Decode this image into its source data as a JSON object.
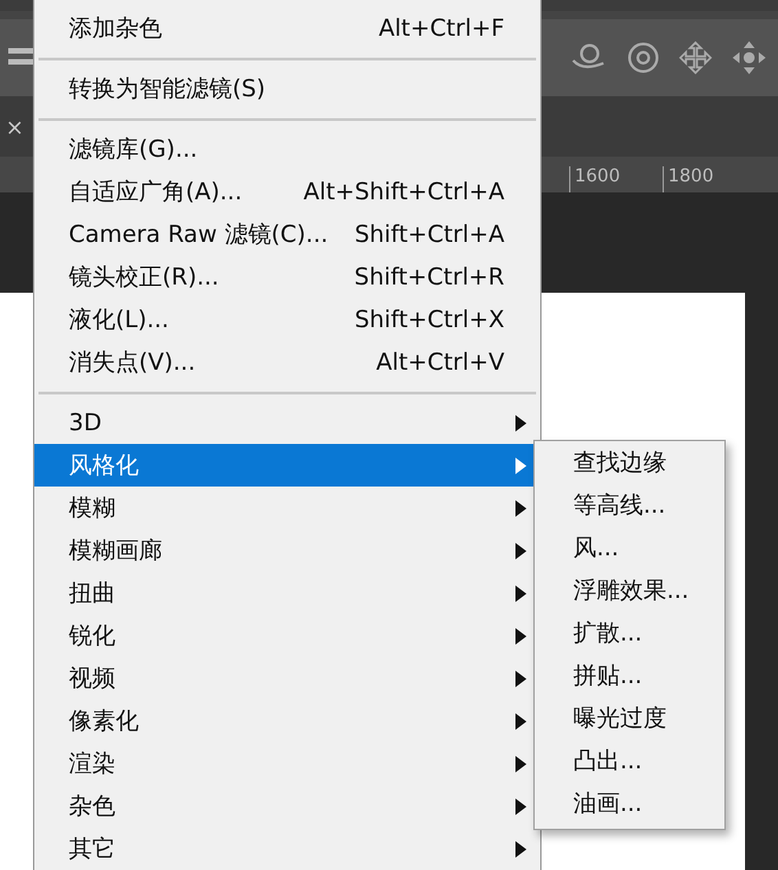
{
  "tab_bar": {
    "close": "×"
  },
  "ruler": {
    "labels": [
      "1600",
      "1800"
    ]
  },
  "menu": {
    "items": [
      {
        "kind": "item",
        "label": "添加杂色",
        "shortcut": "Alt+Ctrl+F"
      },
      {
        "kind": "separator"
      },
      {
        "kind": "item",
        "label": "转换为智能滤镜(S)"
      },
      {
        "kind": "separator"
      },
      {
        "kind": "item",
        "label": "滤镜库(G)..."
      },
      {
        "kind": "item",
        "label": "自适应广角(A)...",
        "shortcut": "Alt+Shift+Ctrl+A"
      },
      {
        "kind": "item",
        "label": "Camera Raw 滤镜(C)...",
        "shortcut": "Shift+Ctrl+A"
      },
      {
        "kind": "item",
        "label": "镜头校正(R)...",
        "shortcut": "Shift+Ctrl+R"
      },
      {
        "kind": "item",
        "label": "液化(L)...",
        "shortcut": "Shift+Ctrl+X"
      },
      {
        "kind": "item",
        "label": "消失点(V)...",
        "shortcut": "Alt+Ctrl+V"
      },
      {
        "kind": "separator"
      },
      {
        "kind": "submenu",
        "label": "3D",
        "selected": false
      },
      {
        "kind": "submenu",
        "label": "风格化",
        "selected": true
      },
      {
        "kind": "submenu",
        "label": "模糊",
        "selected": false
      },
      {
        "kind": "submenu",
        "label": "模糊画廊",
        "selected": false
      },
      {
        "kind": "submenu",
        "label": "扭曲",
        "selected": false
      },
      {
        "kind": "submenu",
        "label": "锐化",
        "selected": false
      },
      {
        "kind": "submenu",
        "label": "视频",
        "selected": false
      },
      {
        "kind": "submenu",
        "label": "像素化",
        "selected": false
      },
      {
        "kind": "submenu",
        "label": "渲染",
        "selected": false
      },
      {
        "kind": "submenu",
        "label": "杂色",
        "selected": false
      },
      {
        "kind": "submenu",
        "label": "其它",
        "selected": false
      }
    ]
  },
  "submenu": {
    "items": [
      "查找边缘",
      "等高线...",
      "风...",
      "浮雕效果...",
      "扩散...",
      "拼贴...",
      "曝光过度",
      "凸出...",
      "油画..."
    ]
  }
}
